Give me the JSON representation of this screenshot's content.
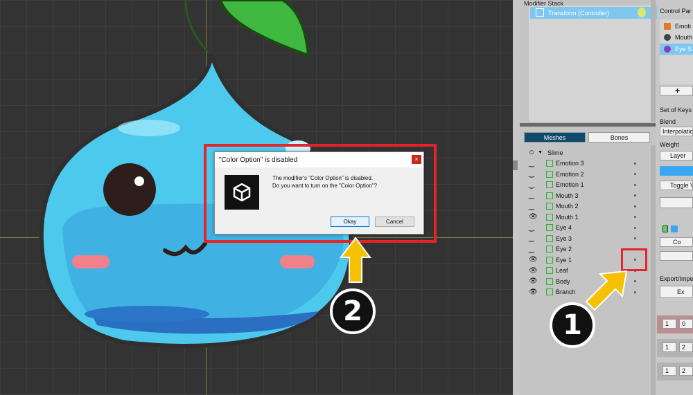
{
  "dialog": {
    "title": "\"Color Option\" is disabled",
    "close_glyph": "×",
    "message_line1": "The modifier's \"Color Option\" is disabled.",
    "message_line2": "Do you want to turn on the \"Color Option\"?",
    "okay_label": "Okay",
    "cancel_label": "Cancel"
  },
  "callouts": {
    "one": "1",
    "two": "2"
  },
  "modifier_stack": {
    "header": "Modifier Stack",
    "item_label": "Transform (Controller)"
  },
  "tabs": {
    "meshes": "Meshes",
    "bones": "Bones"
  },
  "tree": {
    "root": "Slime",
    "rows": [
      {
        "label": "Emotion 3",
        "visible": false
      },
      {
        "label": "Emotion 2",
        "visible": false
      },
      {
        "label": "Emotion 1",
        "visible": false
      },
      {
        "label": "Mouth 3",
        "visible": false
      },
      {
        "label": "Mouth 2",
        "visible": false
      },
      {
        "label": "Mouth 1",
        "visible": true
      },
      {
        "label": "Eye 4",
        "visible": false
      },
      {
        "label": "Eye 3",
        "visible": false
      },
      {
        "label": "Eye 2",
        "visible": false
      },
      {
        "label": "Eye 1",
        "visible": true
      },
      {
        "label": "Leaf",
        "visible": true
      },
      {
        "label": "Body",
        "visible": true
      },
      {
        "label": "Branch",
        "visible": true
      }
    ]
  },
  "control_col": {
    "header": "Control Par",
    "items": [
      "Emoti",
      "Mouth",
      "Eye S"
    ],
    "add_glyph": "+",
    "set_of_keys": "Set of Keys",
    "blend": "Blend",
    "interpolation": "Interpolatio",
    "weight": "Weight",
    "layer": "Layer",
    "toggle": "Toggle V",
    "color_label": "Co",
    "export_import": "Export/Impe",
    "export_btn": "Ex",
    "n1a": "1",
    "n1b": "0",
    "n2a": "1",
    "n2b": "2",
    "n3a": "1",
    "n3b": "2"
  }
}
